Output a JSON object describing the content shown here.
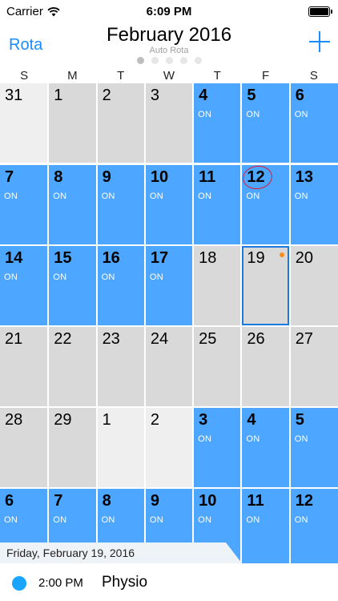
{
  "status_bar": {
    "carrier": "Carrier",
    "time": "6:09 PM"
  },
  "nav": {
    "left_label": "Rota",
    "title": "February 2016",
    "subtitle": "Auto Rota",
    "page_count": 5,
    "active_page": 0,
    "add_icon": "plus-icon"
  },
  "weekdays": [
    "S",
    "M",
    "T",
    "W",
    "T",
    "F",
    "S"
  ],
  "colors": {
    "on": "#4da6ff",
    "off_current_month": "#d9d9d9",
    "off_other_month": "#efefef",
    "accent": "#1a8cff"
  },
  "on_label": "ON",
  "weeks": [
    [
      {
        "day": "31",
        "state": "other"
      },
      {
        "day": "1",
        "state": "off"
      },
      {
        "day": "2",
        "state": "off"
      },
      {
        "day": "3",
        "state": "off"
      },
      {
        "day": "4",
        "state": "on"
      },
      {
        "day": "5",
        "state": "on"
      },
      {
        "day": "6",
        "state": "on"
      }
    ],
    [
      {
        "day": "7",
        "state": "on"
      },
      {
        "day": "8",
        "state": "on"
      },
      {
        "day": "9",
        "state": "on"
      },
      {
        "day": "10",
        "state": "on"
      },
      {
        "day": "11",
        "state": "on"
      },
      {
        "day": "12",
        "state": "on",
        "circled": true
      },
      {
        "day": "13",
        "state": "on"
      }
    ],
    [
      {
        "day": "14",
        "state": "on"
      },
      {
        "day": "15",
        "state": "on"
      },
      {
        "day": "16",
        "state": "on"
      },
      {
        "day": "17",
        "state": "on"
      },
      {
        "day": "18",
        "state": "off"
      },
      {
        "day": "19",
        "state": "off",
        "selected": true,
        "event_dot": true
      },
      {
        "day": "20",
        "state": "off"
      }
    ],
    [
      {
        "day": "21",
        "state": "off"
      },
      {
        "day": "22",
        "state": "off"
      },
      {
        "day": "23",
        "state": "off"
      },
      {
        "day": "24",
        "state": "off"
      },
      {
        "day": "25",
        "state": "off"
      },
      {
        "day": "26",
        "state": "off"
      },
      {
        "day": "27",
        "state": "off"
      }
    ],
    [
      {
        "day": "28",
        "state": "off"
      },
      {
        "day": "29",
        "state": "off"
      },
      {
        "day": "1",
        "state": "other"
      },
      {
        "day": "2",
        "state": "other"
      },
      {
        "day": "3",
        "state": "on"
      },
      {
        "day": "4",
        "state": "on"
      },
      {
        "day": "5",
        "state": "on"
      }
    ],
    [
      {
        "day": "6",
        "state": "on"
      },
      {
        "day": "7",
        "state": "on"
      },
      {
        "day": "8",
        "state": "on"
      },
      {
        "day": "9",
        "state": "on"
      },
      {
        "day": "10",
        "state": "on"
      },
      {
        "day": "11",
        "state": "on"
      },
      {
        "day": "12",
        "state": "on"
      }
    ]
  ],
  "selected_day": {
    "header": "Friday, February 19, 2016",
    "events": [
      {
        "time": "2:00 PM",
        "title": "Physio",
        "color": "#1aa6ff"
      }
    ]
  }
}
